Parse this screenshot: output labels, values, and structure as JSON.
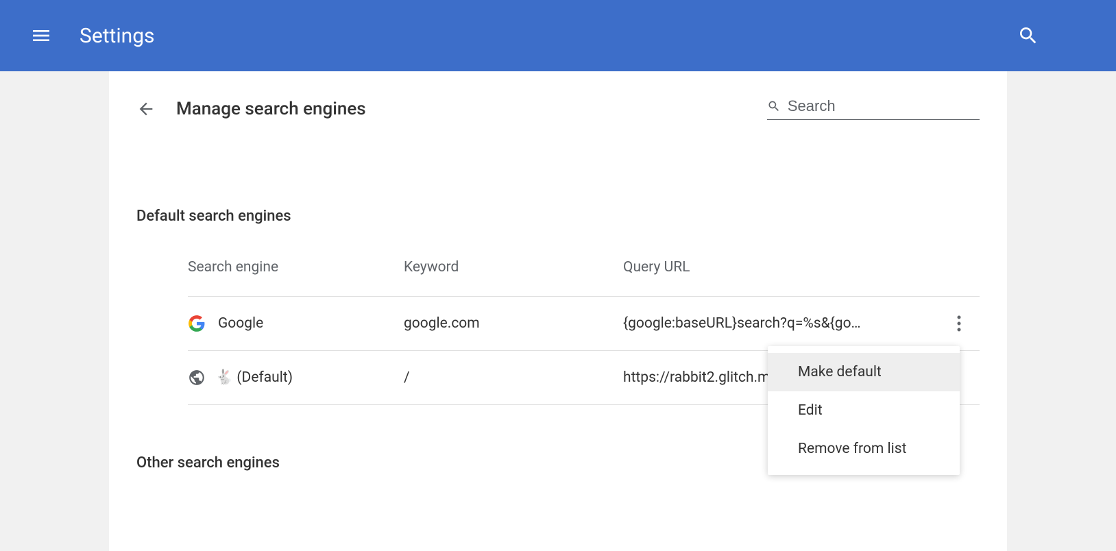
{
  "header": {
    "title": "Settings"
  },
  "page": {
    "title": "Manage search engines",
    "search_placeholder": "Search"
  },
  "sections": {
    "default_title": "Default search engines",
    "other_title": "Other search engines"
  },
  "table": {
    "columns": {
      "engine": "Search engine",
      "keyword": "Keyword",
      "url": "Query URL"
    },
    "rows": [
      {
        "icon": "google",
        "name": "Google",
        "keyword": "google.com",
        "url": "{google:baseURL}search?q=%s&{go…"
      },
      {
        "icon": "globe",
        "name": "🐇  (Default)",
        "keyword": "/",
        "url": "https://rabbit2.glitch.m"
      }
    ]
  },
  "menu": {
    "make_default": "Make default",
    "edit": "Edit",
    "remove": "Remove from list"
  }
}
